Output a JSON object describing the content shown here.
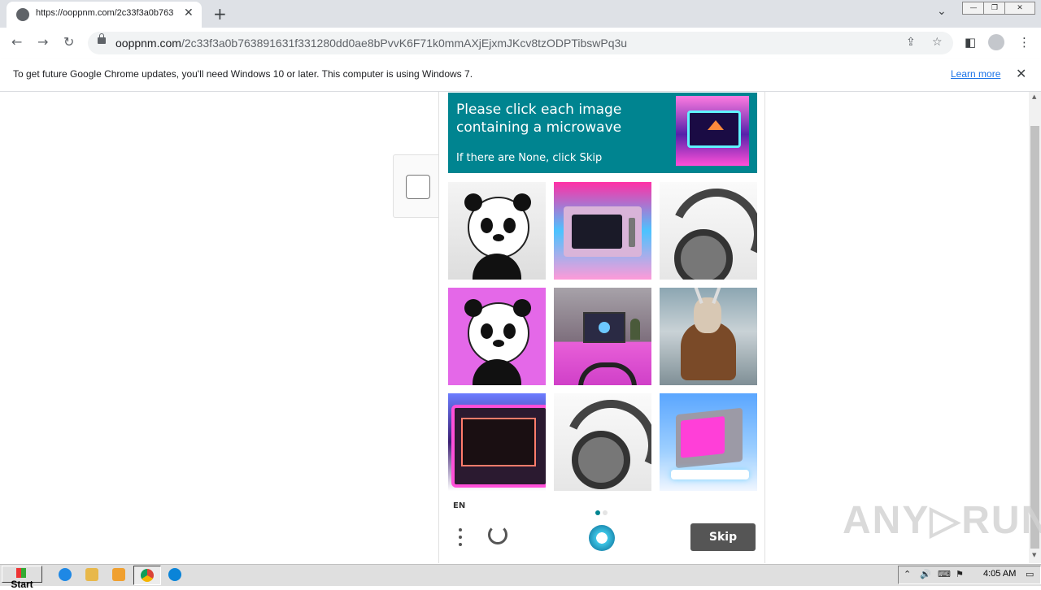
{
  "browser": {
    "tab_title": "https://ooppnm.com/2c33f3a0b763",
    "tab_close": "✕",
    "new_tab": "+",
    "tab_search": "⌄",
    "url_domain": "ooppnm.com",
    "url_path": "/2c33f3a0b763891631f331280dd0ae8bPvvK6F71k0mmAXjEjxmJKcv8tzODPTibswPq3u",
    "back": "←",
    "forward": "→",
    "reload": "↻",
    "share": "⇪",
    "star": "☆",
    "sidepanel": "◧",
    "more": "⋮",
    "win_min": "—",
    "win_max": "❐",
    "win_close": "✕"
  },
  "infobar": {
    "message": "To get future Google Chrome updates, you'll need Windows 10 or later. This computer is using Windows 7.",
    "learn_more": "Learn more",
    "close": "✕"
  },
  "captcha": {
    "prompt_line": "Please click each image containing a microwave",
    "prompt_sub": "If there are None, click Skip",
    "tiles": [
      "panda",
      "microwave",
      "headphones",
      "panda",
      "desk",
      "goat",
      "microwave",
      "headphones",
      "microwave"
    ],
    "language": "EN",
    "skip_label": "Skip",
    "accent_color": "#008490",
    "page_dots": 2,
    "active_dot": 0
  },
  "watermark": "ANY▷RUN",
  "taskbar": {
    "start_label": "Start",
    "clock": "4:05 AM",
    "tray_icons": [
      "⌃",
      "🔊",
      "⌨",
      "⚑",
      "▭"
    ]
  }
}
